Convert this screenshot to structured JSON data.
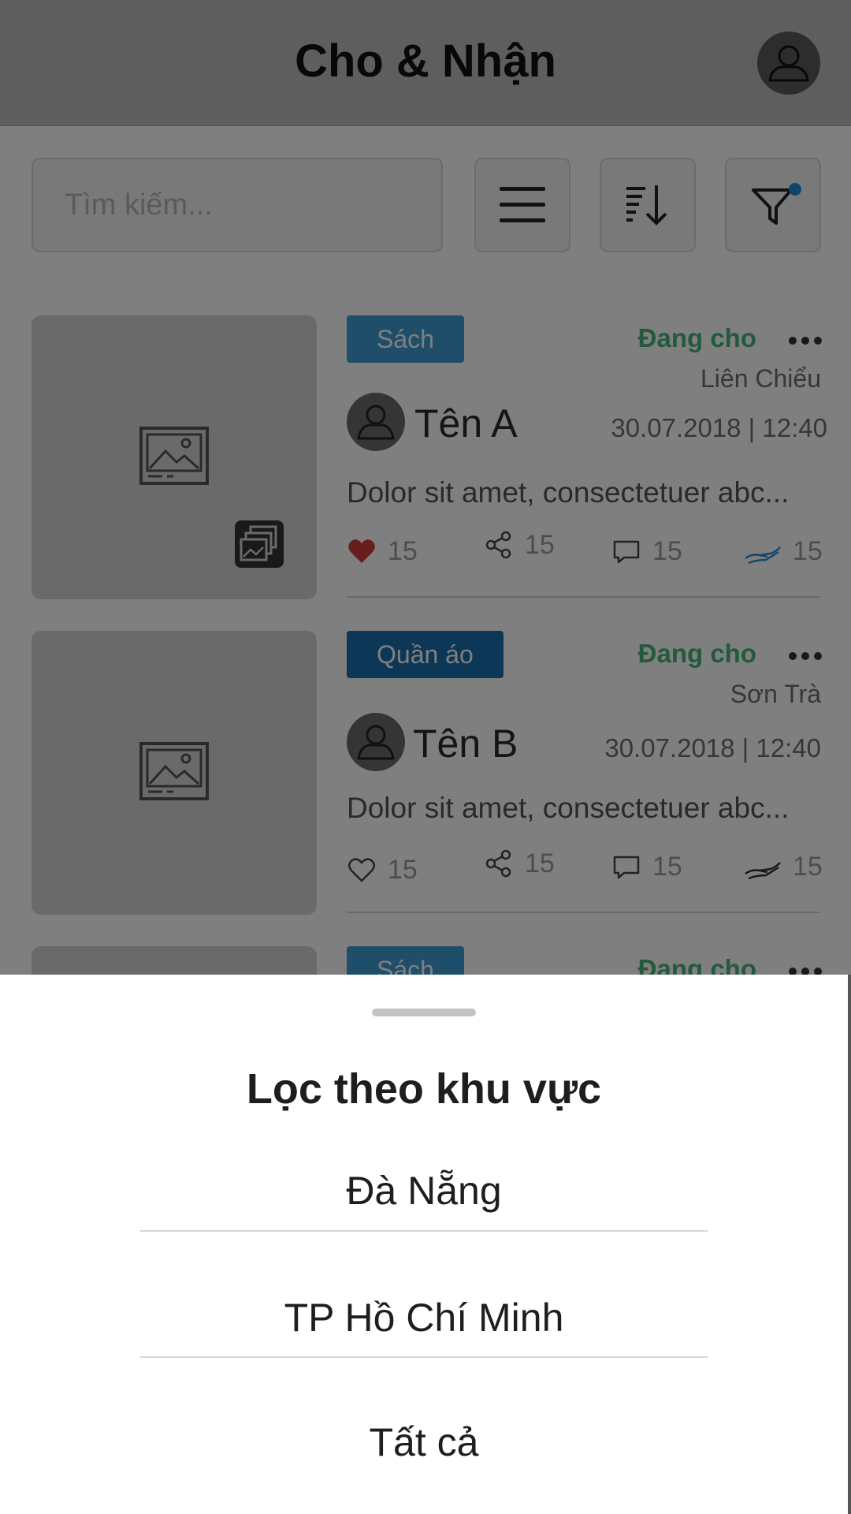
{
  "header": {
    "title": "Cho & Nhận",
    "avatar_icon": "user-avatar-icon"
  },
  "toolbar": {
    "search_placeholder": "Tìm kiếm...",
    "menu_icon": "menu-icon",
    "sort_icon": "sort-icon",
    "filter_icon": "filter-icon",
    "filter_active": true
  },
  "posts": [
    {
      "category": "Sách",
      "status": "Đang cho",
      "district": "Liên Chiểu",
      "user_name": "Tên A",
      "time": "30.07.2018 | 12:40",
      "description": "Dolor sit amet, consectetuer abc...",
      "likes": "15",
      "shares": "15",
      "comments": "15",
      "gives": "15",
      "liked": true,
      "multiple_images": true
    },
    {
      "category": "Quần áo",
      "status": "Đang cho",
      "district": "Sơn Trà",
      "user_name": "Tên B",
      "time": "30.07.2018 | 12:40",
      "description": "Dolor sit amet, consectetuer abc...",
      "likes": "15",
      "shares": "15",
      "comments": "15",
      "gives": "15",
      "liked": false,
      "multiple_images": false
    },
    {
      "category": "Sách",
      "status": "Đang cho"
    }
  ],
  "bottom_sheet": {
    "title": "Lọc theo khu vực",
    "options": [
      "Đà Nẵng",
      "TP Hồ Chí Minh",
      "Tất cả"
    ]
  },
  "colors": {
    "status_green": "#47b57a",
    "badge_blue_light": "#3d9cd4",
    "badge_blue_dark": "#1a6fae",
    "heart_red": "#d23c3c",
    "give_blue": "#2a8fd0",
    "filter_dot": "#1f8ad6"
  }
}
